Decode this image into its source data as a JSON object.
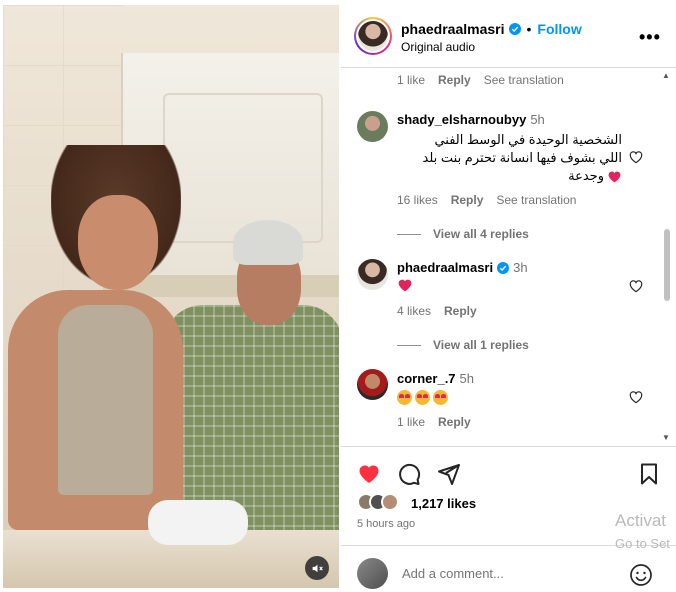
{
  "post": {
    "username": "phaedraalmasri",
    "follow_label": "Follow",
    "audio": "Original audio",
    "more": "•••"
  },
  "comments": {
    "top_meta": {
      "likes": "1 like",
      "reply": "Reply",
      "translate": "See translation"
    },
    "items": [
      {
        "username": "shady_elsharnoubyy",
        "time": "5h",
        "lines": [
          "الشخصية الوحيدة في الوسط الفني",
          "اللي بشوف فيها انسانة تحترم بنت بلد",
          "وجدعة"
        ],
        "likes": "16 likes",
        "reply": "Reply",
        "translate": "See translation",
        "view_replies": "View all 4 replies"
      },
      {
        "username": "phaedraalmasri",
        "time": "3h",
        "likes": "4 likes",
        "reply": "Reply",
        "view_replies": "View all 1 replies"
      },
      {
        "username": "corner_.7",
        "time": "5h",
        "likes": "1 like",
        "reply": "Reply"
      }
    ]
  },
  "footer": {
    "likes": "1,217 likes",
    "posted": "5 hours ago",
    "comment_placeholder": "Add a comment..."
  },
  "watermark": {
    "line1": "Activat",
    "line2": "Go to Set"
  },
  "colors": {
    "accent": "#0095f6",
    "heart": "#ff3040",
    "muted": "#737373"
  }
}
